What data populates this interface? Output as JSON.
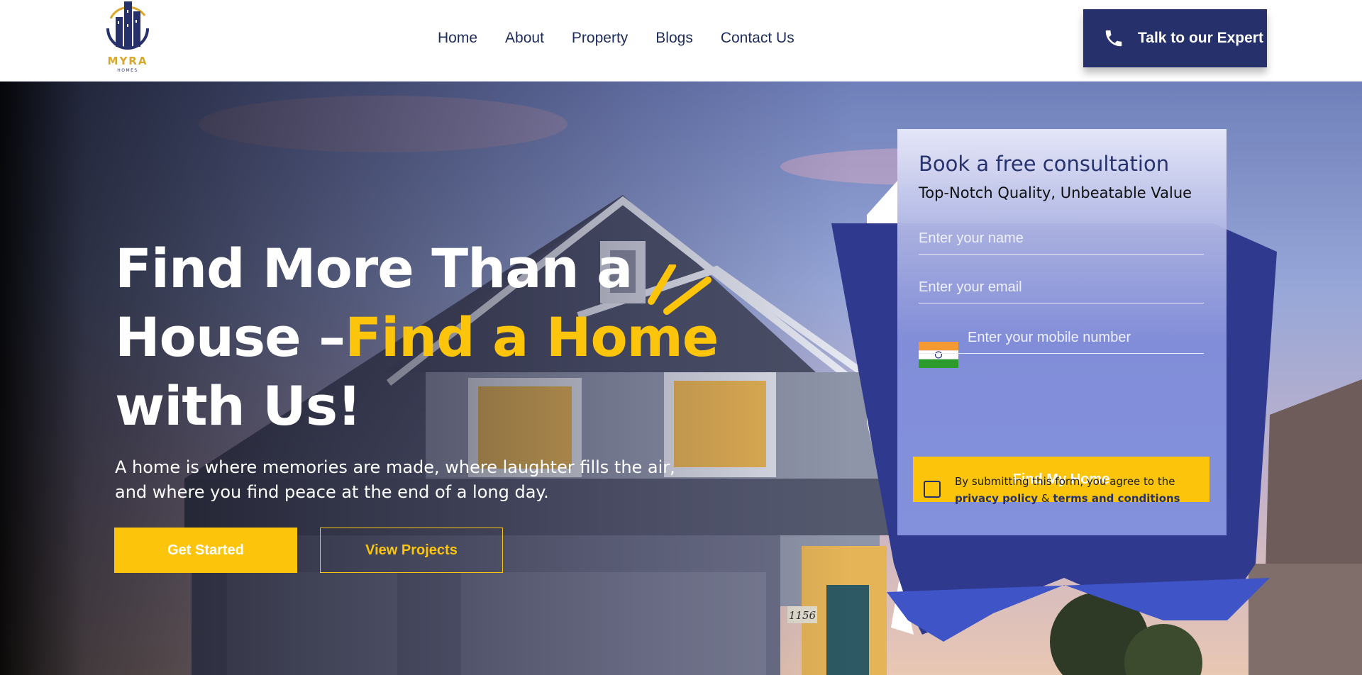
{
  "brand": {
    "logo_name": "MYRA",
    "logo_sub": "HOMES",
    "color_primary": "#26306b",
    "color_accent": "#fcc40a"
  },
  "nav": {
    "items": [
      {
        "label": "Home"
      },
      {
        "label": "About"
      },
      {
        "label": "Property"
      },
      {
        "label": "Blogs"
      },
      {
        "label": "Contact Us"
      }
    ],
    "cta_label": "Talk to our Expert",
    "cta_icon": "phone-icon"
  },
  "hero": {
    "headline_part1": "Find More Than a",
    "headline_part2": "House –",
    "headline_accent": "Find a Home",
    "headline_part3": "with Us!",
    "subtext": "A home is where memories are made, where laughter fills the air, and where you find peace at the end of a long day.",
    "primary_button": "Get Started",
    "secondary_button": "View Projects"
  },
  "form": {
    "title": "Book a free consultation",
    "subtitle": "Top-Notch Quality, Unbeatable Value",
    "name_placeholder": "Enter your name",
    "email_placeholder": "Enter your email",
    "mobile_placeholder": "Enter your mobile number",
    "country_flag": "india-flag-icon",
    "submit_label": "Find My Home",
    "consent_text": "By submitting this form, you agree to the",
    "privacy_link": "privacy policy",
    "consent_and": "&",
    "terms_link": "terms and conditions"
  },
  "scene": {
    "house_number": "1156"
  }
}
